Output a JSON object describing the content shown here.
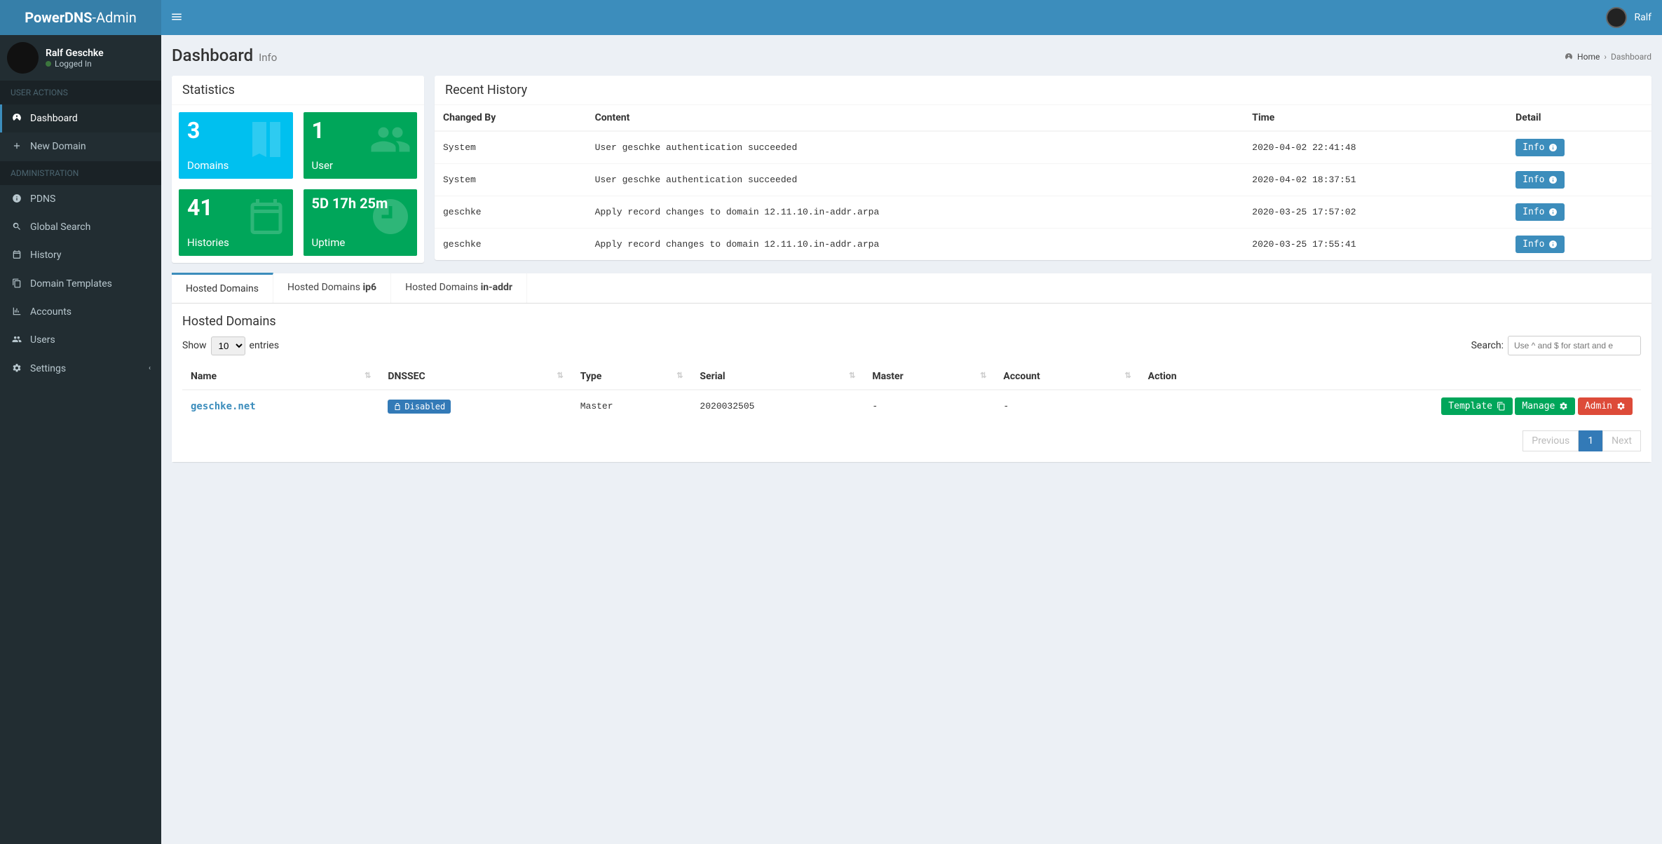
{
  "brand": {
    "bold": "PowerDNS",
    "light": "-Admin"
  },
  "topbar": {
    "username": "Ralf"
  },
  "user_panel": {
    "name": "Ralf Geschke",
    "status": "Logged In"
  },
  "nav": {
    "user_actions_header": "USER ACTIONS",
    "admin_header": "ADMINISTRATION",
    "dashboard": "Dashboard",
    "new_domain": "New Domain",
    "pdns": "PDNS",
    "global_search": "Global Search",
    "history": "History",
    "domain_templates": "Domain Templates",
    "accounts": "Accounts",
    "users": "Users",
    "settings": "Settings"
  },
  "header": {
    "title": "Dashboard",
    "subtitle": "Info"
  },
  "breadcrumb": {
    "home": "Home",
    "current": "Dashboard"
  },
  "statistics": {
    "title": "Statistics",
    "cards": [
      {
        "value": "3",
        "label": "Domains"
      },
      {
        "value": "1",
        "label": "User"
      },
      {
        "value": "41",
        "label": "Histories"
      },
      {
        "value": "5D 17h 25m",
        "label": "Uptime"
      }
    ]
  },
  "recent_history": {
    "title": "Recent History",
    "columns": {
      "changed_by": "Changed By",
      "content": "Content",
      "time": "Time",
      "detail": "Detail"
    },
    "info_btn": "Info",
    "rows": [
      {
        "by": "System",
        "content": "User geschke authentication succeeded",
        "time": "2020-04-02 22:41:48"
      },
      {
        "by": "System",
        "content": "User geschke authentication succeeded",
        "time": "2020-04-02 18:37:51"
      },
      {
        "by": "geschke",
        "content": "Apply record changes to domain 12.11.10.in-addr.arpa",
        "time": "2020-03-25 17:57:02"
      },
      {
        "by": "geschke",
        "content": "Apply record changes to domain 12.11.10.in-addr.arpa",
        "time": "2020-03-25 17:55:41"
      }
    ]
  },
  "tabs": {
    "t0": {
      "base": "Hosted Domains",
      "suffix": ""
    },
    "t1": {
      "base": "Hosted Domains ",
      "suffix": "ip6"
    },
    "t2": {
      "base": "Hosted Domains ",
      "suffix": "in-addr"
    }
  },
  "hosted_domains": {
    "title": "Hosted Domains",
    "show_label": "Show",
    "entries_label": "entries",
    "page_size": "10",
    "search_label": "Search:",
    "search_placeholder": "Use ^ and $ for start and e",
    "columns": {
      "name": "Name",
      "dnssec": "DNSSEC",
      "type": "Type",
      "serial": "Serial",
      "master": "Master",
      "account": "Account",
      "action": "Action"
    },
    "dnssec_disabled": "Disabled",
    "btn_template": "Template",
    "btn_manage": "Manage",
    "btn_admin": "Admin",
    "rows": [
      {
        "name": "geschke.net",
        "type": "Master",
        "serial": "2020032505",
        "master": "-",
        "account": "-"
      }
    ],
    "pagination": {
      "prev": "Previous",
      "page": "1",
      "next": "Next"
    }
  }
}
